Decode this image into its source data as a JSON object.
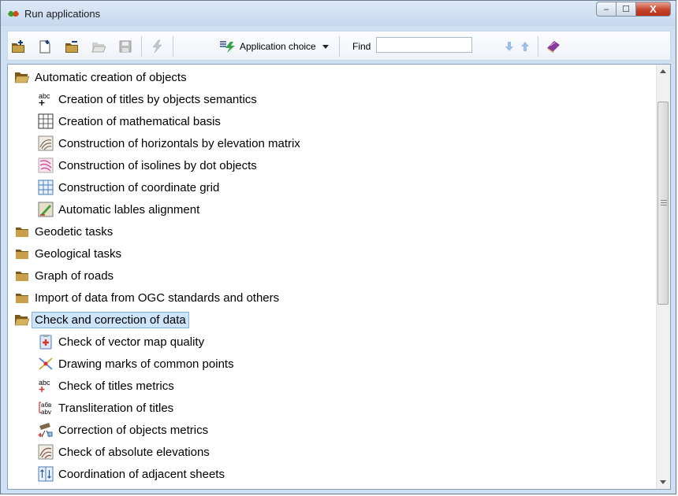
{
  "window": {
    "title": "Run applications",
    "minimize_glyph": "–",
    "maximize_glyph": "☐",
    "close_glyph": "X"
  },
  "toolbar": {
    "icons": [
      "add-folder-icon",
      "new-document-icon",
      "remove-folder-icon",
      "open-folder-icon",
      "save-icon",
      "run-icon",
      "application-choice-icon",
      "down-arrow-icon",
      "up-arrow-icon",
      "book-icon"
    ],
    "application_choice_label": "Application choice",
    "find_label": "Find",
    "find_value": ""
  },
  "tree": {
    "rows": [
      {
        "label": "Automatic creation of objects",
        "type": "folder",
        "expanded": true,
        "icon": "folder-open-icon"
      },
      {
        "label": "Creation of titles by objects semantics",
        "type": "item",
        "icon": "abc-plus-icon"
      },
      {
        "label": "Creation of mathematical basis",
        "type": "item",
        "icon": "math-grid-icon"
      },
      {
        "label": "Construction of horizontals by elevation matrix",
        "type": "item",
        "icon": "contour-icon"
      },
      {
        "label": "Construction of isolines by dot objects",
        "type": "item",
        "icon": "isolines-icon"
      },
      {
        "label": "Construction of coordinate grid",
        "type": "item",
        "icon": "coordinate-grid-icon"
      },
      {
        "label": "Automatic lables alignment",
        "type": "item",
        "icon": "label-alignment-icon"
      },
      {
        "label": "Geodetic tasks",
        "type": "folder",
        "expanded": false,
        "icon": "folder-icon"
      },
      {
        "label": "Geological tasks",
        "type": "folder",
        "expanded": false,
        "icon": "folder-icon"
      },
      {
        "label": "Graph of roads",
        "type": "folder",
        "expanded": false,
        "icon": "folder-icon"
      },
      {
        "label": "Import of data from OGC standards and others",
        "type": "folder",
        "expanded": false,
        "icon": "folder-icon"
      },
      {
        "label": "Check and correction of data",
        "type": "folder",
        "expanded": true,
        "selected": true,
        "icon": "folder-open-icon"
      },
      {
        "label": "Check of vector map quality",
        "type": "item",
        "icon": "map-quality-icon"
      },
      {
        "label": "Drawing marks of common points",
        "type": "item",
        "icon": "common-points-icon"
      },
      {
        "label": "Check of titles metrics",
        "type": "item",
        "icon": "abc-plus-red-icon"
      },
      {
        "label": "Transliteration of titles",
        "type": "item",
        "icon": "transliteration-icon"
      },
      {
        "label": "Correction of objects metrics",
        "type": "item",
        "icon": "telescope-icon"
      },
      {
        "label": "Check of absolute elevations",
        "type": "item",
        "icon": "elevation-contour-icon"
      },
      {
        "label": "Coordination of adjacent sheets",
        "type": "item",
        "icon": "adjacent-sheets-icon"
      }
    ]
  },
  "colors": {
    "selection_bg": "#cde4fb",
    "selection_border": "#7fb3e6",
    "folder": "#c8a04a"
  }
}
